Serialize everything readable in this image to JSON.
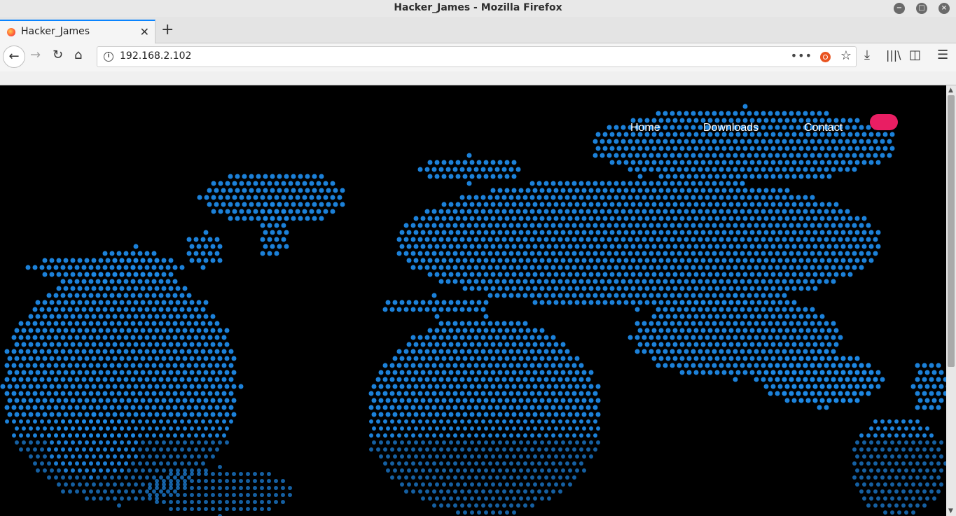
{
  "window": {
    "title": "Hacker_James - Mozilla Firefox",
    "controls": [
      "minimize-icon",
      "maximize-icon",
      "close-icon"
    ]
  },
  "tabs": [
    {
      "label": "Hacker_James",
      "active": true
    }
  ],
  "toolbar": {
    "url": "192.168.2.102",
    "icons": [
      "back-icon",
      "forward-icon",
      "reload-icon",
      "home-icon",
      "info-icon",
      "page-actions-icon",
      "ubuntu-icon",
      "bookmark-star-icon",
      "downloads-icon",
      "library-icon",
      "sidebar-icon",
      "menu-icon"
    ]
  },
  "page": {
    "nav": {
      "home": "Home",
      "downloads": "Downloads",
      "contact": "Contact"
    },
    "accent_color": "#e91e63",
    "background_color": "#000000",
    "map_dot_color": "#1e88e5"
  }
}
